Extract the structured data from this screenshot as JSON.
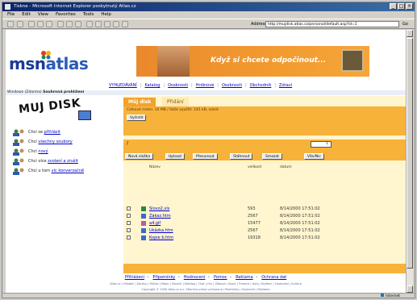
{
  "window": {
    "title": "Tiskne - Microsoft Internet Explorer poskytnutý Atlas.cz",
    "menu": [
      "File",
      "Edit",
      "View",
      "Favorites",
      "Tools",
      "Help"
    ],
    "address_label": "Address",
    "address": "http://mujdisk.atlas.cz/personal/default.asp?id=1",
    "go_label": "Go",
    "status_zone": "Internet"
  },
  "site": {
    "logo_msn": "msn",
    "logo_atlas": "atlas",
    "banner_text": "Když si chcete odpočinout...",
    "nav": [
      "VYHLEDÁVÁNÍ",
      "Katalog",
      "Osobnosti",
      "Hrdinové",
      "Osobnosti",
      "Obchodník",
      "Zdraví"
    ],
    "breadcrumb_prefix": "Windows (Zdarma)",
    "breadcrumb_current": "Souhrnná prohlížení",
    "heading": "MUJ DISK"
  },
  "sidebar": {
    "items": [
      {
        "prefix": "Chci se",
        "link": "přihlásit"
      },
      {
        "prefix": "Chci",
        "link": "všechny soubory"
      },
      {
        "prefix": "Chci",
        "link": "nový"
      },
      {
        "prefix": "Chci více",
        "link": "zvolení a zrušit"
      },
      {
        "prefix": "Chci u tom",
        "link": "víc konverzačně"
      }
    ]
  },
  "panel": {
    "tab_active": "Můj disk",
    "tab_inactive": "Přidání",
    "info_line": "Celkové místo: 10 MB / Vaše využití: 145 kB, volné",
    "info_button": "Vyčistit",
    "folder": "/",
    "select_value": "1",
    "buttons": [
      "Nová složka",
      "Upload",
      "Přesunout",
      "Stáhnout",
      "Smazat",
      "Vše/Nic"
    ],
    "columns": {
      "name": "Název",
      "size": "velikost",
      "date": "datum"
    },
    "files": [
      {
        "name": "Slovo2.xls",
        "size": "593",
        "date": "8/14/2000 17:51:02"
      },
      {
        "name": "Zákaz.htm",
        "size": "2567",
        "date": "8/14/2000 17:51:02"
      },
      {
        "name": "a4.gif",
        "size": "15477",
        "date": "8/14/2000 17:51:02"
      },
      {
        "name": "Ukázka.htm",
        "size": "2567",
        "date": "8/14/2000 17:51:02"
      },
      {
        "name": "Kopie b.htm",
        "size": "19318",
        "date": "8/14/2000 17:51:02"
      }
    ]
  },
  "footer": {
    "links": [
      "Příhlášení",
      "Připomínky",
      "Hodnocení",
      "Pomoc",
      "Reklama",
      "Ochrana dat"
    ],
    "small_line1": "Atlas.cz | Hledání | Zprávy | Počasí | Mapy | Slovník | Katalog | Chat | Hry | Zábava | Sport | Finance | Auto | Bydlení | Cestování | Kultura",
    "small_line2": "Copyright © 2000 Atlas.cz a.s. Všechna práva vyhrazena | Podmínky | Soukromí | Reklama"
  },
  "colors": {
    "orange": "#f7b23a",
    "orange_dark": "#f2a22e",
    "panel_bg": "#fff5cf",
    "link": "#0000cc",
    "msn_blue": "#1a3a96"
  }
}
